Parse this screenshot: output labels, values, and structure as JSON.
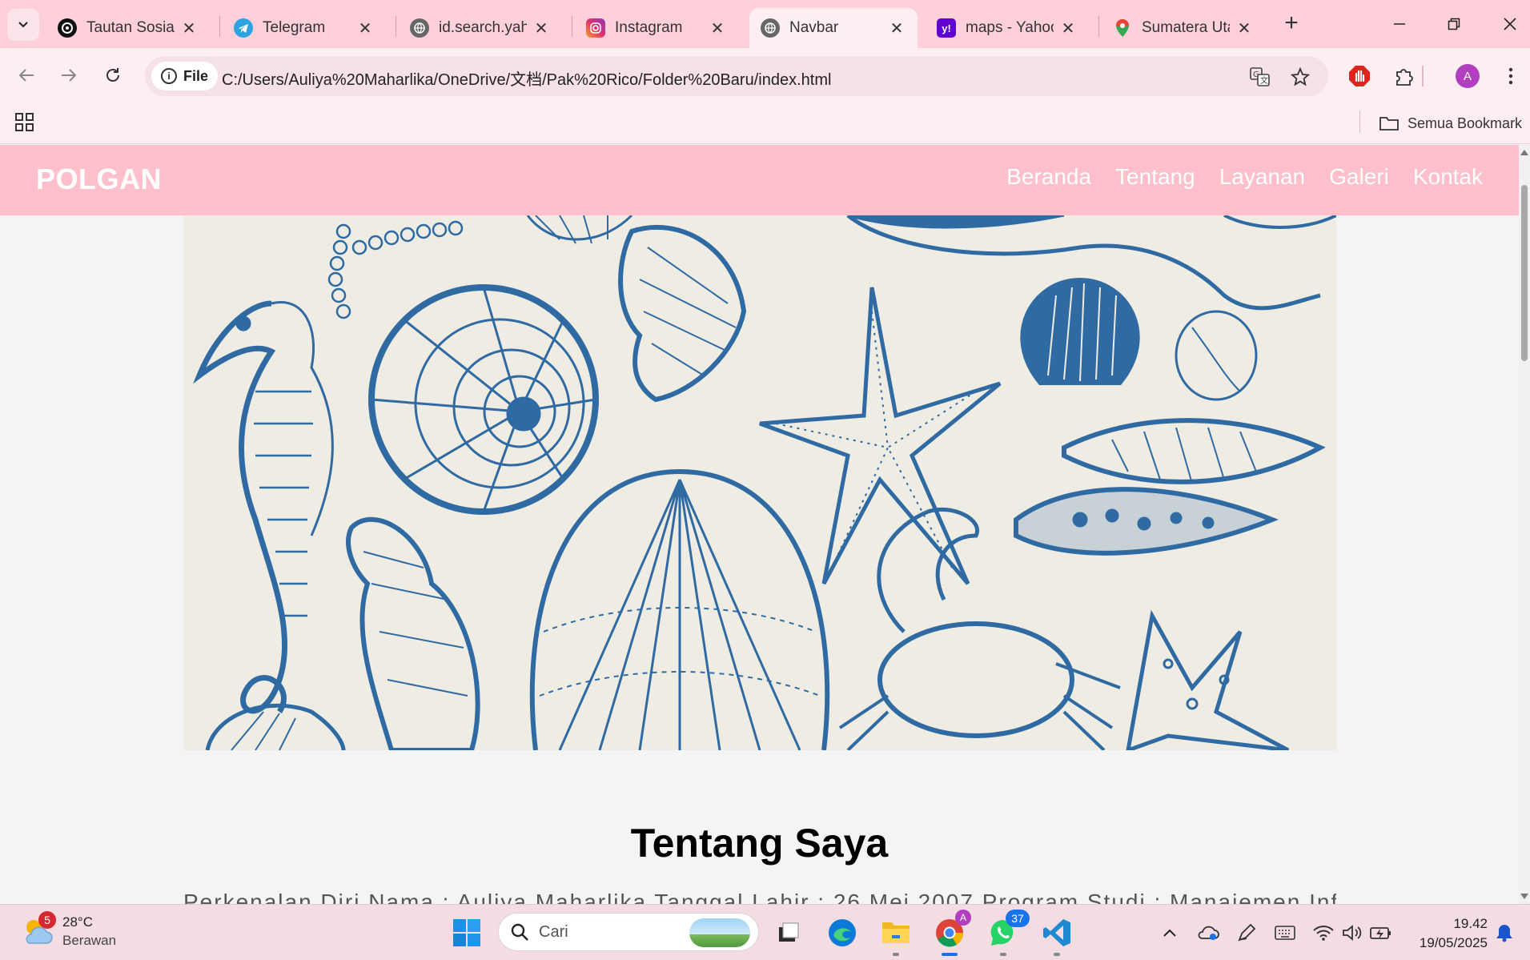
{
  "browser": {
    "tabs": [
      {
        "title": "Tautan Sosial",
        "icon": "openai-icon"
      },
      {
        "title": "Telegram",
        "icon": "telegram-icon"
      },
      {
        "title": "id.search.yahoo",
        "icon": "globe-icon"
      },
      {
        "title": "Instagram",
        "icon": "instagram-icon"
      },
      {
        "title": "Navbar",
        "icon": "globe-icon",
        "active": true
      },
      {
        "title": "maps - Yahoo",
        "icon": "yahoo-icon"
      },
      {
        "title": "Sumatera Utara",
        "icon": "google-maps-icon"
      }
    ],
    "address": {
      "scheme_chip": "File",
      "url": "C:/Users/Auliya%20Maharlika/OneDrive/文档/Pak%20Rico/Folder%20Baru/index.html"
    },
    "profile_initial": "A",
    "bookmarks": {
      "all_label": "Semua Bookmark"
    }
  },
  "page": {
    "brand": "POLGAN",
    "nav": [
      "Beranda",
      "Tentang",
      "Layanan",
      "Galeri",
      "Kontak"
    ],
    "hero_alt": "",
    "about_title": "Tentang Saya",
    "about_text": "Perkenalan Diri Nama : Auliya Maharlika Tanggal Lahir : 26 Mei 2007 Program Studi : Manajemen Informatika"
  },
  "taskbar": {
    "weather": {
      "temp": "28°C",
      "condition": "Berawan",
      "badge": "5"
    },
    "search_placeholder": "Cari",
    "whatsapp_badge": "37",
    "chrome_profile_badge": "A",
    "time": "19.42",
    "date": "19/05/2025"
  },
  "colors": {
    "tabstrip": "#fdd0dc",
    "toolbar": "#fdeef2",
    "site_nav": "#ffc0cb",
    "hero_ink": "#2f6aa3",
    "hero_paper": "#efece3"
  }
}
